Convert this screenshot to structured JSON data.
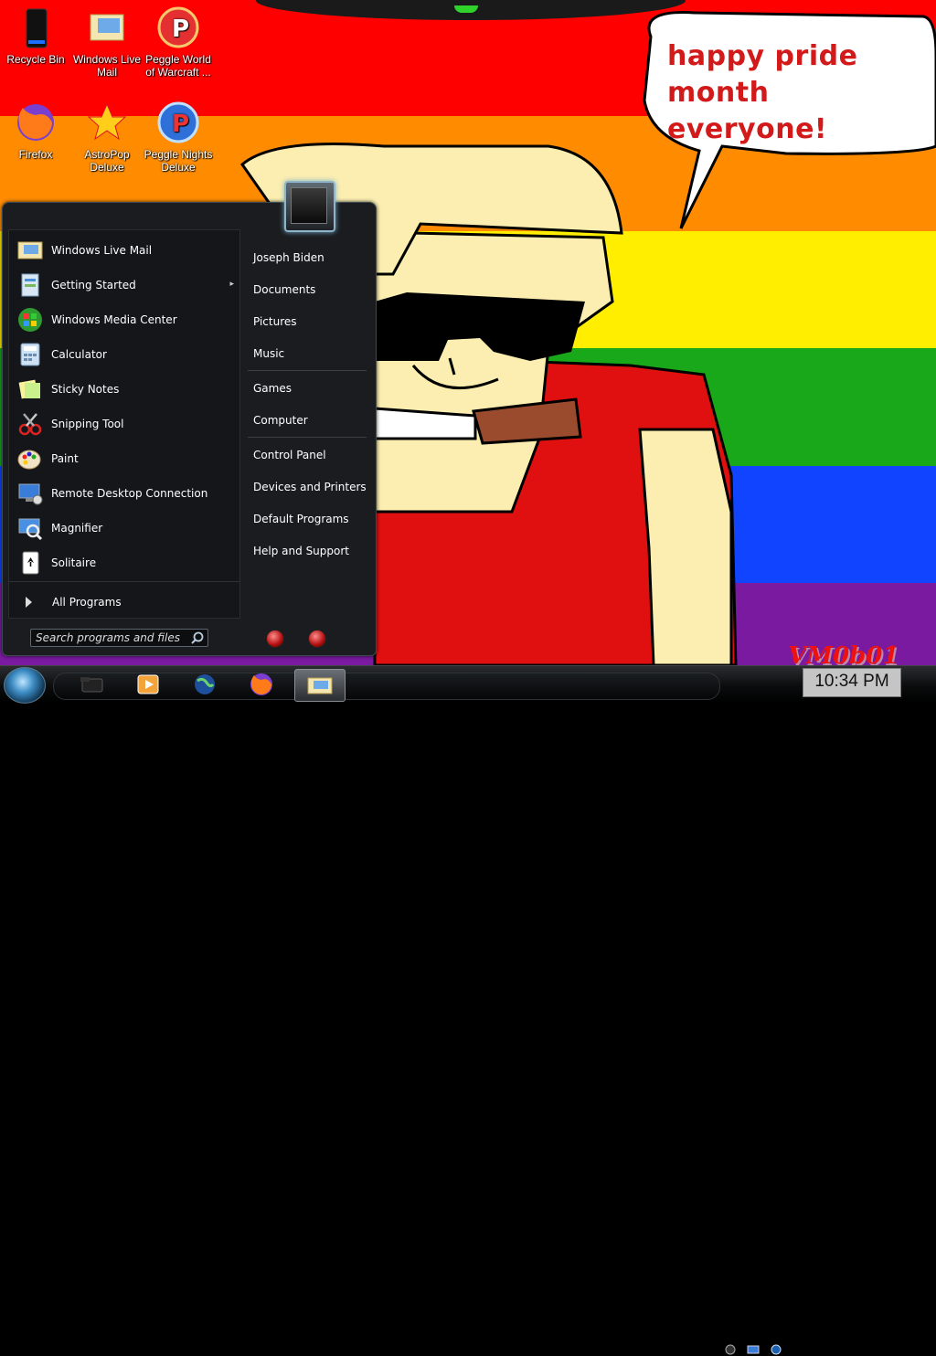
{
  "desktop": {
    "icons": [
      {
        "label": "Recycle Bin",
        "icon": "recycle-bin-icon"
      },
      {
        "label": "Windows Live Mail",
        "icon": "mail-icon"
      },
      {
        "label": "Peggle World of Warcraft ...",
        "icon": "peggle-icon"
      },
      {
        "label": "Firefox",
        "icon": "firefox-icon"
      },
      {
        "label": "AstroPop Deluxe",
        "icon": "astropop-icon"
      },
      {
        "label": "Peggle Nights Deluxe",
        "icon": "peggle-nights-icon"
      }
    ],
    "wallpaper_text": "happy pride month everyone!",
    "wallpaper_text_line1": "happy pride month",
    "wallpaper_text_line2": "everyone!",
    "watermark": "VM0b01",
    "stripe_colors": [
      "#ff0000",
      "#ff8c00",
      "#ffee00",
      "#18a81a",
      "#1144ff",
      "#7a1aa0"
    ]
  },
  "start_menu": {
    "left_items": [
      {
        "label": "Windows Live Mail",
        "icon": "mail-icon"
      },
      {
        "label": "Getting Started",
        "icon": "getting-started-icon",
        "has_submenu": true
      },
      {
        "label": "Windows Media Center",
        "icon": "media-center-icon"
      },
      {
        "label": "Calculator",
        "icon": "calculator-icon"
      },
      {
        "label": "Sticky Notes",
        "icon": "sticky-notes-icon"
      },
      {
        "label": "Snipping Tool",
        "icon": "snipping-tool-icon"
      },
      {
        "label": "Paint",
        "icon": "paint-icon"
      },
      {
        "label": "Remote Desktop Connection",
        "icon": "remote-desktop-icon"
      },
      {
        "label": "Magnifier",
        "icon": "magnifier-icon"
      },
      {
        "label": "Solitaire",
        "icon": "solitaire-icon"
      }
    ],
    "all_programs": "All Programs",
    "search_placeholder": "Search programs and files",
    "right_items": [
      {
        "label": "Joseph Biden"
      },
      {
        "label": "Documents"
      },
      {
        "label": "Pictures"
      },
      {
        "label": "Music"
      },
      {
        "label": "Games"
      },
      {
        "label": "Computer"
      },
      {
        "label": "Control Panel"
      },
      {
        "label": "Devices and Printers"
      },
      {
        "label": "Default Programs"
      },
      {
        "label": "Help and Support"
      }
    ]
  },
  "taskbar": {
    "pinned": [
      "explorer-icon",
      "media-player-icon",
      "globe-icon",
      "firefox-icon",
      "mail-icon"
    ],
    "clock": "10:34 PM"
  }
}
